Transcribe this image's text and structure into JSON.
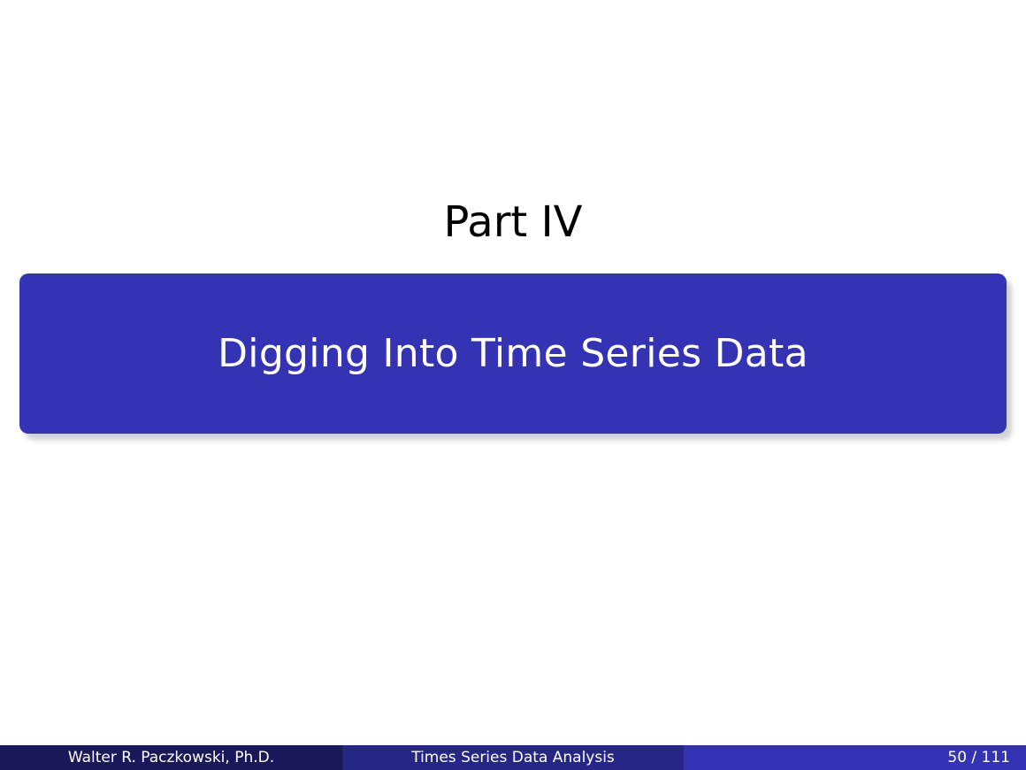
{
  "part": {
    "label": "Part IV",
    "name": "Digging Into Time Series Data"
  },
  "footer": {
    "author": "Walter R. Paczkowski, Ph.D.",
    "title": "Times Series Data Analysis",
    "page": "50 / 111"
  },
  "colors": {
    "accent": "#3333b3",
    "footer_left": "#191959",
    "footer_middle": "#262686",
    "footer_right": "#3333b3"
  }
}
